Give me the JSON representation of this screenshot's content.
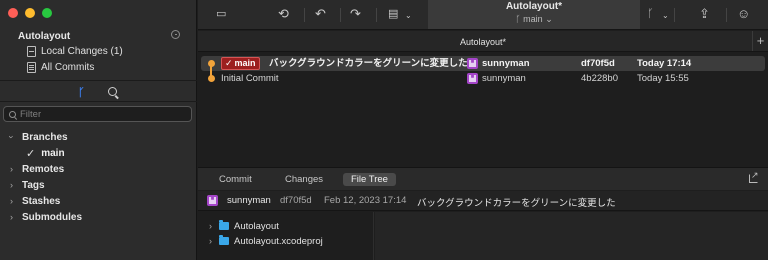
{
  "repo": {
    "name": "Autolayout",
    "local_changes": "Local Changes (1)",
    "all_commits": "All Commits"
  },
  "sidebar": {
    "filter_placeholder": "Filter",
    "sections": {
      "branches": "Branches",
      "remotes": "Remotes",
      "tags": "Tags",
      "stashes": "Stashes",
      "submodules": "Submodules"
    },
    "current_branch": "main"
  },
  "toolbar": {
    "title": "Autolayout*",
    "branch": "main",
    "icons": [
      "folder-icon",
      "fetch-icon",
      "pull-icon",
      "push-icon",
      "stash-icon",
      "branch-icon",
      "share-icon",
      "emoji-icon"
    ]
  },
  "tab": {
    "label": "Autolayout*",
    "plus": "+"
  },
  "commits": [
    {
      "branch_badge": "main",
      "message": "バックグラウンドカラーをグリーンに変更した",
      "author": "sunnyman",
      "hash": "df70f5d",
      "date": "Today 17:14",
      "selected": true
    },
    {
      "branch_badge": "",
      "message": "Initial Commit",
      "author": "sunnyman",
      "hash": "4b228b0",
      "date": "Today 15:55",
      "selected": false
    }
  ],
  "detail": {
    "tabs": [
      "Commit",
      "Changes",
      "File Tree"
    ],
    "active_tab": "File Tree",
    "author": "sunnyman",
    "hash": "df70f5d",
    "date": "Feb 12, 2023 17:14",
    "message": "バックグラウンドカラーをグリーンに変更した"
  },
  "file_tree": [
    {
      "name": "Autolayout"
    },
    {
      "name": "Autolayout.xcodeproj"
    }
  ],
  "colors": {
    "branch_accent": "#3c82f6",
    "graph": "#f2a33a",
    "badge_bg": "#9c1f1f",
    "avatar": "#a445c8",
    "folder": "#3aa7e8"
  }
}
